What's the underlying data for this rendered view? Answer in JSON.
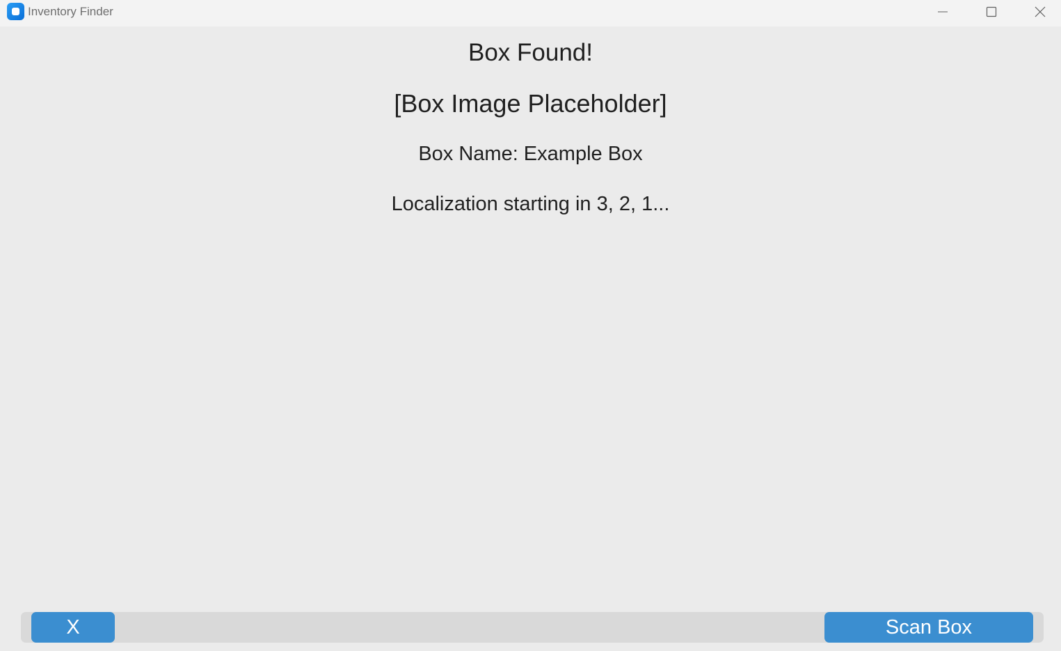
{
  "window": {
    "title": "Inventory Finder",
    "app_icon": "app-icon",
    "controls": [
      "minimize-icon",
      "maximize-icon",
      "close-icon"
    ]
  },
  "main": {
    "heading": "Box Found!",
    "image_placeholder": "[Box Image Placeholder]",
    "box_name": "Box Name: Example Box",
    "countdown": "Localization starting in 3, 2, 1..."
  },
  "bottom_bar": {
    "close_label": "X",
    "scan_label": "Scan Box"
  },
  "colors": {
    "background": "#ebebeb",
    "titlebar": "#f3f3f3",
    "button": "#3b8ed0",
    "button_text": "#ffffff",
    "bar": "#d9d9d9"
  }
}
